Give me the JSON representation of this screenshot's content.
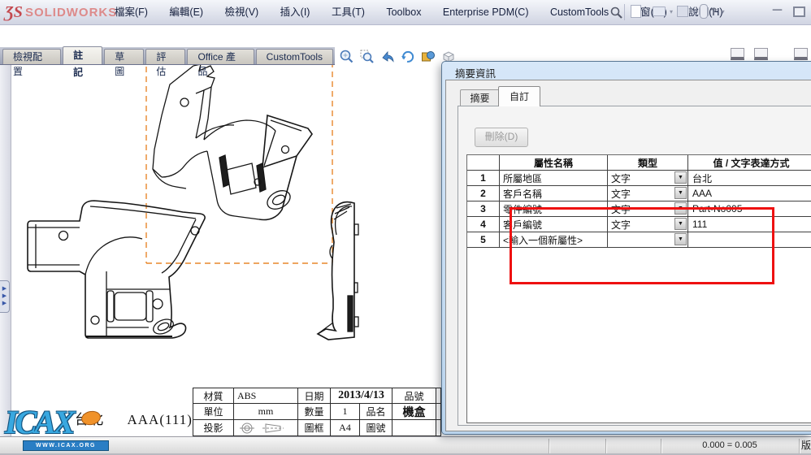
{
  "menubar": {
    "logo": "SOLIDWORKS",
    "items": [
      "檔案(F)",
      "編輯(E)",
      "檢視(V)",
      "插入(I)",
      "工具(T)",
      "Toolbox",
      "Enterprise PDM(C)",
      "CustomTools",
      "視窗(W)",
      "說明(H)"
    ]
  },
  "command_tabs": {
    "items": [
      "檢視配置",
      "註記",
      "草圖",
      "評估",
      "Office 產品",
      "CustomTools"
    ],
    "active": "註記"
  },
  "dialog": {
    "title": "摘要資訊",
    "tabs": [
      "摘要",
      "自訂"
    ],
    "active_tab": "自訂",
    "delete_button": "刪除(D)",
    "grid": {
      "headers": [
        "屬性名稱",
        "類型",
        "值 / 文字表達方式"
      ],
      "rows": [
        {
          "no": "1",
          "name": "所屬地區",
          "type": "文字",
          "value": "台北"
        },
        {
          "no": "2",
          "name": "客戶名稱",
          "type": "文字",
          "value": "AAA"
        },
        {
          "no": "3",
          "name": "零件編號",
          "type": "文字",
          "value": "Part-No005"
        },
        {
          "no": "4",
          "name": "客戶編號",
          "type": "文字",
          "value": "111"
        },
        {
          "no": "5",
          "name": "<輸入一個新屬性>",
          "type": "",
          "value": ""
        }
      ]
    },
    "highlight_color": "#ee1111"
  },
  "drawing": {
    "note": "台北　  AAA(111)",
    "view_border_color": "#e8872c",
    "title_block": {
      "rows": [
        [
          "材質",
          "ABS",
          "日期",
          "2013/4/13",
          "品號",
          ""
        ],
        [
          "單位",
          "mm",
          "數量",
          "1",
          "品名",
          "機盒",
          ""
        ],
        [
          "投影",
          "",
          "圖框",
          "A4",
          "圖號",
          "",
          ""
        ]
      ]
    }
  },
  "watermark": {
    "text": "ICAX",
    "banner": "WWW.ICAX.ORG"
  },
  "statusbar": {
    "coords": "0.000 = 0.005",
    "right": "版"
  },
  "icons": {
    "headsup": [
      "zoom-fit",
      "zoom-area",
      "previous-view",
      "rotate-view",
      "view-settings"
    ],
    "quick_access": [
      "new-document",
      "open-document",
      "save",
      "pdm-vault",
      "help"
    ]
  }
}
